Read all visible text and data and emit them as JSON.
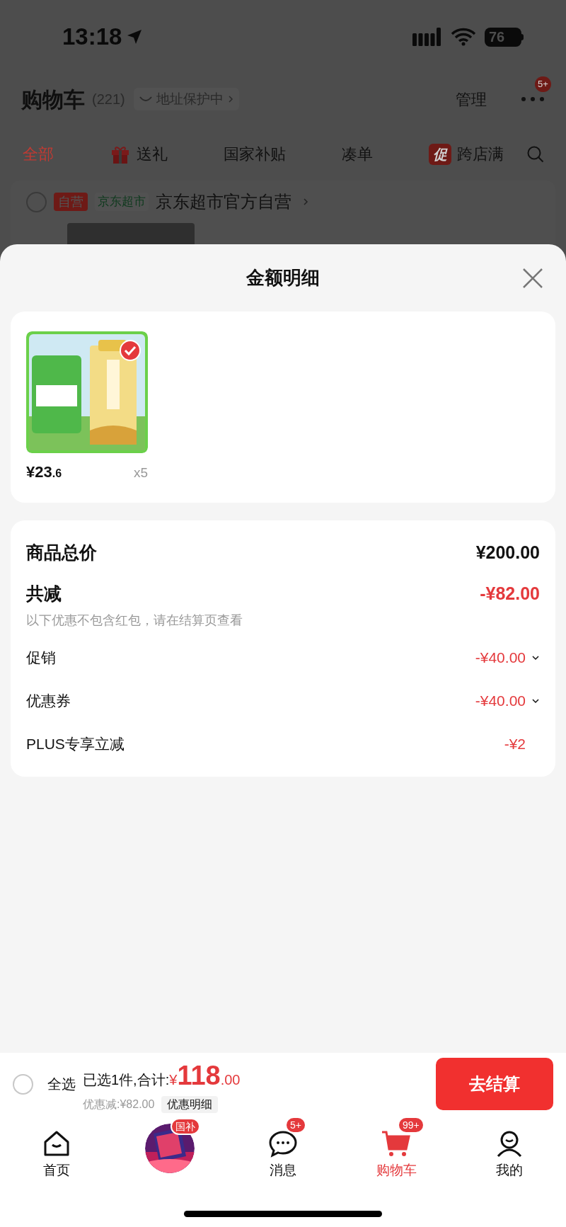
{
  "status_bar": {
    "time": "13:18",
    "battery": "76"
  },
  "header": {
    "title": "购物车",
    "count": "(221)",
    "address_tag": "地址保护中",
    "manage": "管理",
    "more_badge": "5+"
  },
  "filter_tabs": [
    {
      "label": "全部",
      "selected": true,
      "kind": "plain"
    },
    {
      "label": "送礼",
      "selected": false,
      "kind": "gift"
    },
    {
      "label": "国家补贴",
      "selected": false,
      "kind": "plain"
    },
    {
      "label": "凑单",
      "selected": false,
      "kind": "plain"
    },
    {
      "label": "跨店满",
      "selected": false,
      "kind": "promo",
      "tag": "促"
    }
  ],
  "store": {
    "self_tag": "自营",
    "market_tag": "京东超市",
    "name": "京东超市官方自营",
    "checked": false
  },
  "sheet": {
    "title": "金额明细",
    "product": {
      "price_main": "¥23",
      "price_decimal": ".6",
      "quantity": "x5",
      "checked": true
    },
    "summary": [
      {
        "kind": "total",
        "label": "商品总价",
        "amount": "¥200.00"
      },
      {
        "kind": "reduction",
        "label": "共减",
        "amount": "-¥82.00",
        "note": "以下优惠不包含红包，请在结算页查看"
      },
      {
        "kind": "expandable",
        "label": "促销",
        "amount": "-¥40.00",
        "expanded": false
      },
      {
        "kind": "expandable",
        "label": "优惠券",
        "amount": "-¥40.00",
        "expanded": false
      },
      {
        "kind": "item",
        "label": "PLUS专享立减",
        "amount": "-¥2"
      }
    ]
  },
  "checkout_bar": {
    "select_all": "全选",
    "select_all_checked": false,
    "selected_text": "已选1件,合计:",
    "currency": "¥",
    "total_main": "118",
    "total_decimal": ".00",
    "discount": "优惠减:¥82.00",
    "detail_button": "优惠明细",
    "checkout_button": "去结算"
  },
  "bottom_nav": [
    {
      "kind": "home",
      "label": "首页",
      "selected": false
    },
    {
      "kind": "promo",
      "badge": "国补",
      "selected": false
    },
    {
      "kind": "messages",
      "label": "消息",
      "badge": "5+",
      "selected": false
    },
    {
      "kind": "cart",
      "label": "购物车",
      "badge": "99+",
      "selected": true
    },
    {
      "kind": "profile",
      "label": "我的",
      "selected": false
    }
  ]
}
